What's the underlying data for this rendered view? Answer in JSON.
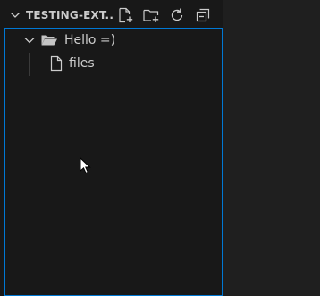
{
  "explorer": {
    "section_title": "TESTING-EXT...",
    "actions": [
      {
        "name": "new-file",
        "icon": "new-file-icon"
      },
      {
        "name": "new-folder",
        "icon": "new-folder-icon"
      },
      {
        "name": "refresh",
        "icon": "refresh-icon"
      },
      {
        "name": "collapse-all",
        "icon": "collapse-all-icon"
      }
    ],
    "tree": {
      "folder": {
        "label": "Hello =)",
        "expanded": true,
        "icon": "folder-open-icon"
      },
      "files": [
        {
          "label": "files",
          "icon": "file-icon"
        }
      ]
    }
  },
  "colors": {
    "sidebar_bg": "#181818",
    "editor_bg": "#1f1f1f",
    "focus_border": "#0078d4",
    "text": "#cccccc"
  }
}
